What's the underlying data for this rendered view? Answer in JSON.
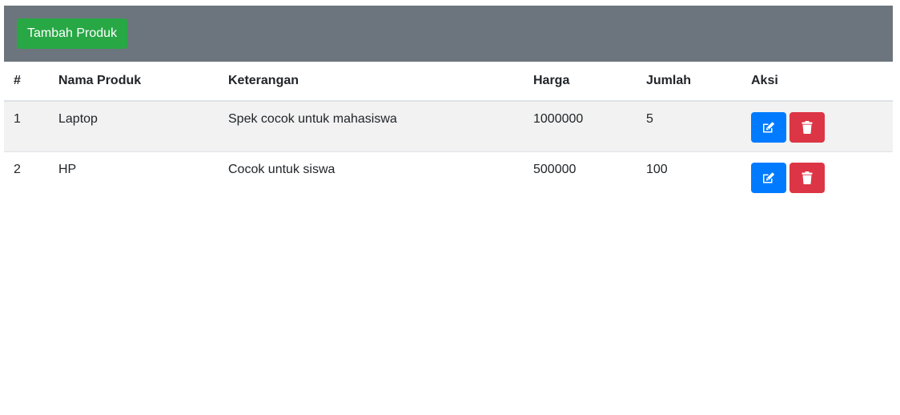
{
  "toolbar": {
    "add_label": "Tambah Produk",
    "background": "#6c757d",
    "add_color": "#28a745"
  },
  "table": {
    "headers": [
      "#",
      "Nama Produk",
      "Keterangan",
      "Harga",
      "Jumlah",
      "Aksi"
    ],
    "rows": [
      {
        "no": "1",
        "name": "Laptop",
        "desc": "Spek cocok untuk mahasiswa",
        "price": "1000000",
        "qty": "5"
      },
      {
        "no": "2",
        "name": "HP",
        "desc": "Cocok untuk siswa",
        "price": "500000",
        "qty": "100"
      }
    ]
  },
  "icons": {
    "edit": "edit-icon",
    "delete": "trash-icon"
  },
  "colors": {
    "edit": "#007bff",
    "delete": "#dc3545",
    "stripe": "#f2f2f2"
  }
}
